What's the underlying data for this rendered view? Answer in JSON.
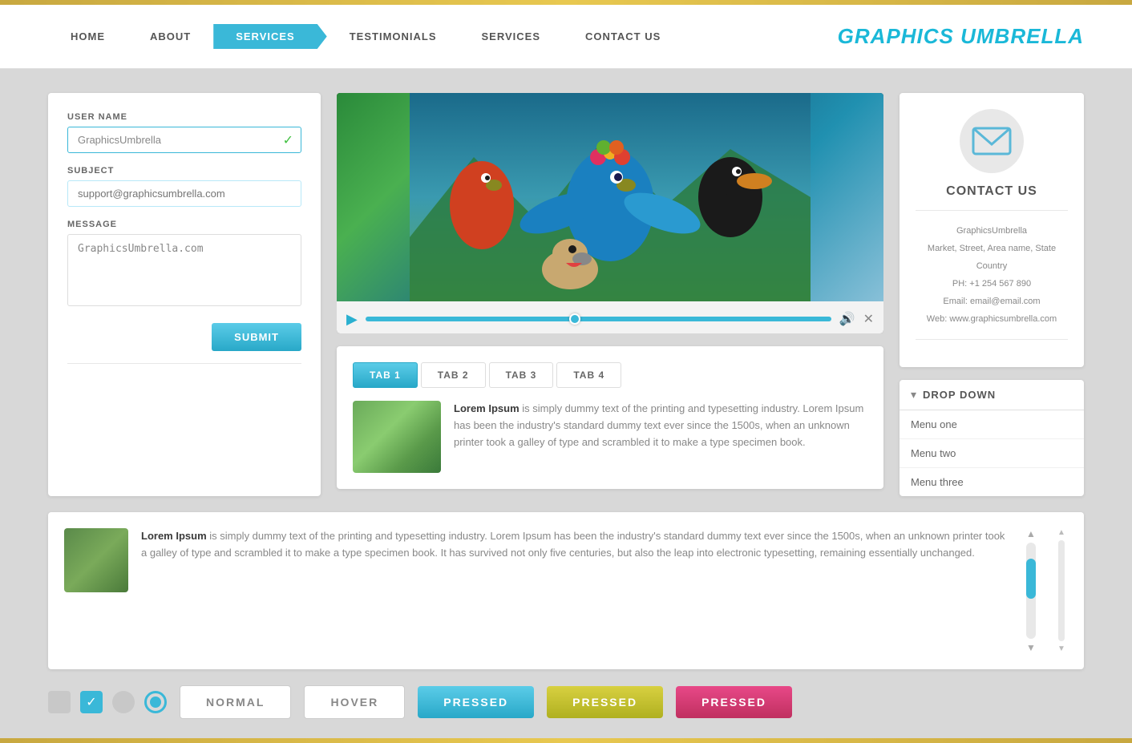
{
  "border": {
    "gold_color": "#c8a840"
  },
  "nav": {
    "items": [
      {
        "label": "HOME",
        "active": false
      },
      {
        "label": "ABOUT",
        "active": false
      },
      {
        "label": "SERVICES",
        "active": true
      },
      {
        "label": "TESTIMONIALS",
        "active": false
      },
      {
        "label": "SERVICES",
        "active": false
      },
      {
        "label": "CONTACT US",
        "active": false
      }
    ],
    "logo": "GRAPHICS UMBRELLA"
  },
  "form": {
    "username_label": "USER NAME",
    "username_value": "GraphicsUmbrella",
    "subject_label": "SUBJECT",
    "subject_placeholder": "support@graphicsumbrella.com",
    "message_label": "MESSAGE",
    "message_value": "GraphicsUmbrella.com",
    "submit_label": "SUBMIT"
  },
  "video": {
    "controls": {
      "play": "▶",
      "volume": "🔊",
      "fullscreen": "✕"
    }
  },
  "tabs": {
    "items": [
      {
        "label": "TAB 1",
        "active": true
      },
      {
        "label": "TAB 2",
        "active": false
      },
      {
        "label": "TAB 3",
        "active": false
      },
      {
        "label": "TAB 4",
        "active": false
      }
    ],
    "content": {
      "bold": "Lorem Ipsum",
      "text": " is simply dummy text of the printing and typesetting industry. Lorem Ipsum has been the industry's standard dummy text ever since the 1500s, when an unknown printer took a galley of type and scrambled it to make a type specimen book."
    }
  },
  "contact": {
    "title": "CONTACT US",
    "name": "GraphicsUmbrella",
    "address1": "Market, Street, Area name, State",
    "address2": "Country",
    "phone": "PH: +1 254 567 890",
    "email": "Email: email@email.com",
    "web": "Web: www.graphicsumbrella.com"
  },
  "dropdown": {
    "title": "DROP DOWN",
    "items": [
      {
        "label": "Menu one"
      },
      {
        "label": "Menu two"
      },
      {
        "label": "Menu three"
      }
    ]
  },
  "scroll_section": {
    "image_bold": "Lorem Ipsum",
    "text": " is simply dummy text of the printing and typesetting industry. Lorem Ipsum has been the industry's standard dummy text ever since the 1500s, when an unknown printer took a galley of type and scrambled it to make a type specimen book. It has survived not only five centuries, but also the leap into electronic typesetting, remaining essentially unchanged."
  },
  "buttons": {
    "normal_label": "NORMAL",
    "hover_label": "HOVER",
    "pressed_blue_label": "PRESSED",
    "pressed_yellow_label": "PRESSED",
    "pressed_pink_label": "PRESSED"
  }
}
